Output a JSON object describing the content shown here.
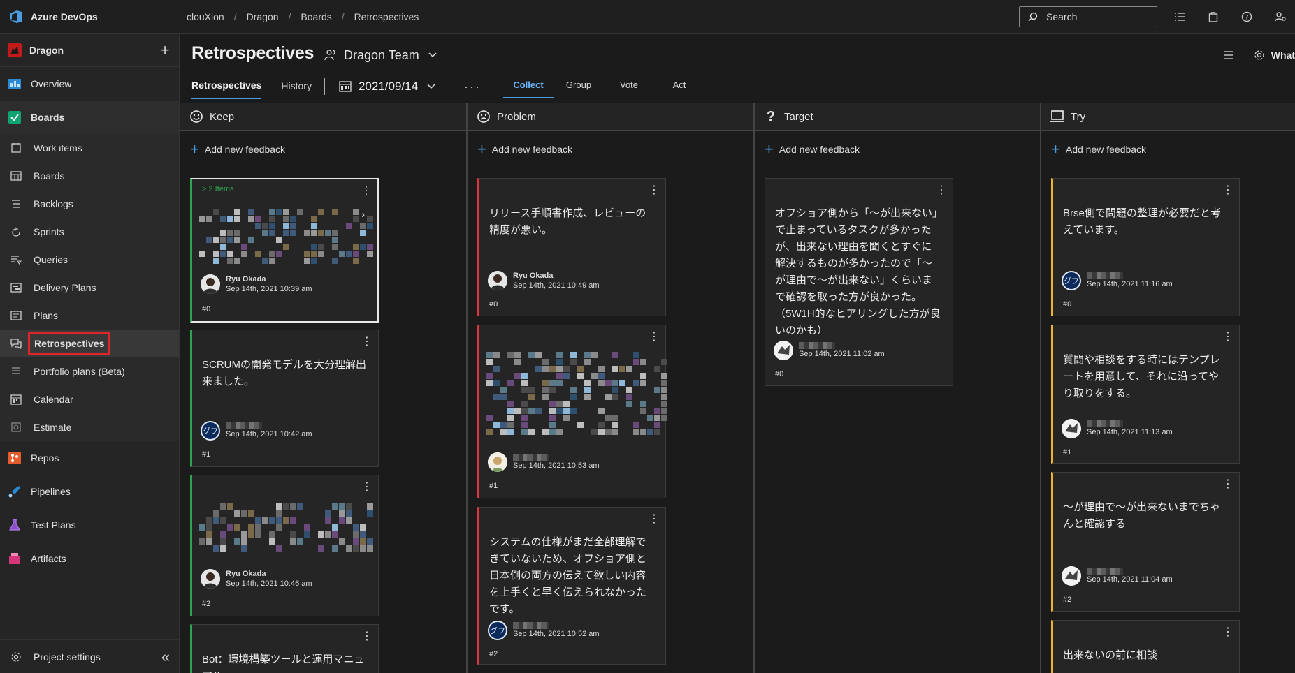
{
  "app": {
    "name": "Azure DevOps",
    "accent": "#4a9de0"
  },
  "breadcrumb": [
    "clouXion",
    "Dragon",
    "Boards",
    "Retrospectives"
  ],
  "search": {
    "placeholder": "Search"
  },
  "sidebar": {
    "project": "Dragon",
    "items": [
      {
        "label": "Overview"
      },
      {
        "label": "Boards"
      },
      {
        "label": "Work items"
      },
      {
        "label": "Boards"
      },
      {
        "label": "Backlogs"
      },
      {
        "label": "Sprints"
      },
      {
        "label": "Queries"
      },
      {
        "label": "Delivery Plans"
      },
      {
        "label": "Plans"
      },
      {
        "label": "Retrospectives"
      },
      {
        "label": "Portfolio plans (Beta)"
      },
      {
        "label": "Calendar"
      },
      {
        "label": "Estimate"
      },
      {
        "label": "Repos"
      },
      {
        "label": "Pipelines"
      },
      {
        "label": "Test Plans"
      },
      {
        "label": "Artifacts"
      }
    ],
    "settings": "Project settings"
  },
  "header": {
    "title": "Retrospectives",
    "team": "Dragon Team",
    "right_label": "What",
    "tabs": [
      "Retrospectives",
      "History"
    ],
    "date": "2021/09/14",
    "phases": [
      "Collect",
      "Group",
      "Vote",
      "Act"
    ]
  },
  "columns": [
    {
      "title": "Keep",
      "add": "Add new feedback"
    },
    {
      "title": "Problem",
      "add": "Add new feedback"
    },
    {
      "title": "Target",
      "add": "Add new feedback"
    },
    {
      "title": "Try",
      "add": "Add new feedback"
    }
  ],
  "cards": {
    "keep": [
      {
        "items": "2 Items",
        "author": "Ryu Okada",
        "time": "Sep 14th, 2021 10:39 am",
        "num": "#0"
      },
      {
        "text": "SCRUMの開発モデルを大分理解出来ました。",
        "avatar": "グフ",
        "time": "Sep 14th, 2021 10:42 am",
        "num": "#1"
      },
      {
        "author": "Ryu Okada",
        "time": "Sep 14th, 2021 10:46 am",
        "num": "#2"
      },
      {
        "text": "Bot：環境構築ツールと運用マニュアル"
      }
    ],
    "problem": [
      {
        "text": "リリース手順書作成、レビューの精度が悪い。",
        "author": "Ryu Okada",
        "time": "Sep 14th, 2021 10:49 am",
        "num": "#0"
      },
      {
        "time": "Sep 14th, 2021 10:53 am",
        "num": "#1"
      },
      {
        "text": "システムの仕様がまだ全部理解できていないため、オフショア側と日本側の両方の伝えて欲しい内容を上手くと早く伝えられなかったです。",
        "avatar": "グフ",
        "time": "Sep 14th, 2021 10:52 am",
        "num": "#2"
      }
    ],
    "target": [
      {
        "text": "オフショア側から「～が出来ない」で止まっているタスクが多かったが、出来ない理由を聞くとすぐに解決するものが多かったので「～が理由で～が出来ない」くらいまで確認を取った方が良かった。（5W1H的なヒアリングした方が良いのかも）",
        "time": "Sep 14th, 2021 11:02 am",
        "num": "#0"
      }
    ],
    "try": [
      {
        "text": "Brse側で問題の整理が必要だと考えています。",
        "avatar": "グフ",
        "time": "Sep 14th, 2021 11:16 am",
        "num": "#0"
      },
      {
        "text": "質問や相談をする時にはテンプレートを用意して、それに沿ってやり取りをする。",
        "time": "Sep 14th, 2021 11:13 am",
        "num": "#1"
      },
      {
        "text": "～が理由で～が出来ないまでちゃんと確認する",
        "time": "Sep 14th, 2021 11:04 am",
        "num": "#2"
      },
      {
        "text": "出来ないの前に相談"
      }
    ]
  }
}
